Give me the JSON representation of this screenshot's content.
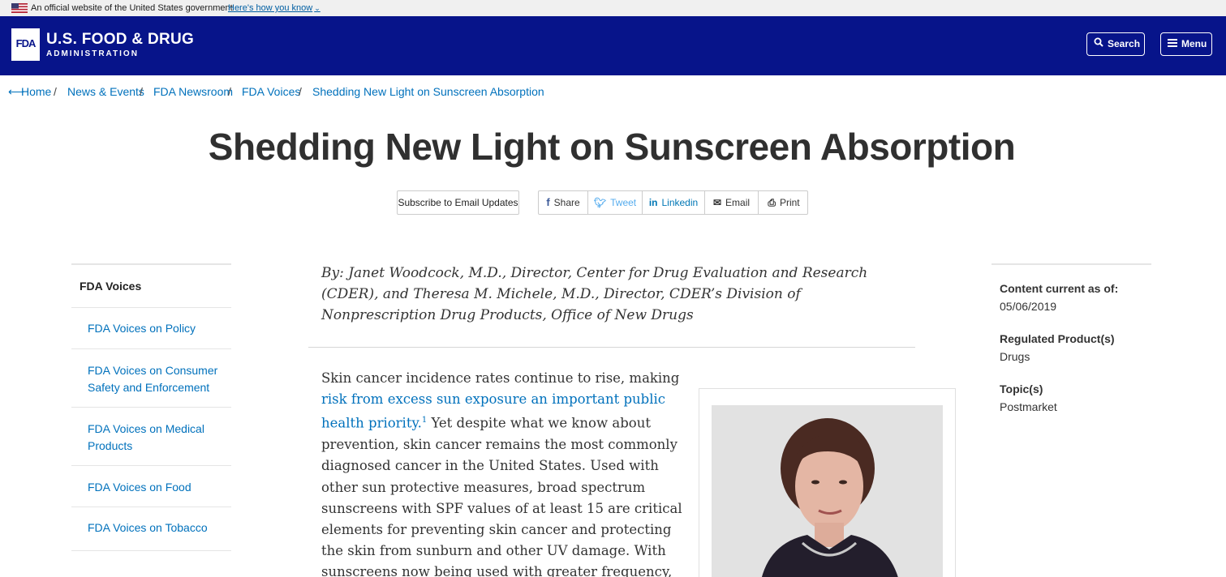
{
  "gov_banner": {
    "official_text": "An official website of the United States government",
    "how_you_know": "Here's how you know"
  },
  "header": {
    "logo_text": "FDA",
    "brand_main": "U.S. FOOD & DRUG",
    "brand_sub": "ADMINISTRATION",
    "search_label": "Search",
    "menu_label": "Menu",
    "bg_color": "#07148a"
  },
  "breadcrumb": {
    "items": [
      "Home",
      "News & Events",
      "FDA Newsroom",
      "FDA Voices",
      "Shedding New Light on Sunscreen Absorption"
    ],
    "separator": "/"
  },
  "page": {
    "title": "Shedding New Light on Sunscreen Absorption"
  },
  "share": {
    "subscribe": "Subscribe to Email Updates",
    "facebook": "Share",
    "twitter": "Tweet",
    "linkedin": "Linkedin",
    "email": "Email",
    "print": "Print"
  },
  "leftnav": {
    "heading": "FDA Voices",
    "items": [
      "FDA Voices on Policy",
      "FDA Voices on Consumer Safety and Enforcement",
      "FDA Voices on Medical Products",
      "FDA Voices on Food",
      "FDA Voices on Tobacco"
    ]
  },
  "article": {
    "byline": "By: Janet Woodcock, M.D., Director, Center for Drug Evaluation and Research (CDER), and Theresa M. Michele, M.D., Director, CDER’s Division of Nonprescription Drug Products, Office of New Drugs",
    "para_intro": "Skin cancer incidence rates continue to rise, making ",
    "para_link": "risk from excess sun exposure an important public health priority.",
    "para_sup": "1",
    "para_rest": " Yet despite what we know about prevention, skin cancer remains the most commonly diagnosed cancer in the United States. Used with other sun protective measures, broad spectrum sunscreens with SPF values of at least 15 are critical elements for preventing skin cancer and protecting the skin from sunburn and other UV damage. With sunscreens now being used with greater frequency, in larger amounts,"
  },
  "sidebar": {
    "content_current_label": "Content current as of:",
    "content_current_value": "05/06/2019",
    "regulated_label": "Regulated Product(s)",
    "regulated_value": "Drugs",
    "topics_label": "Topic(s)",
    "topics_value": "Postmarket"
  }
}
